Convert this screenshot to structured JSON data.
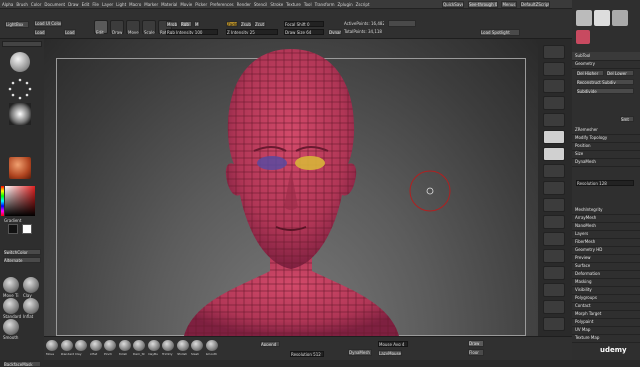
{
  "menubar": {
    "items": [
      "Alpha",
      "Brush",
      "Color",
      "Document",
      "Draw",
      "Edit",
      "File",
      "Layer",
      "Light",
      "Macro",
      "Marker",
      "Material",
      "Movie",
      "Picker",
      "Preferences",
      "Render",
      "Stencil",
      "Stroke",
      "Texture",
      "Tool",
      "Transform",
      "Zplugin",
      "Zscript"
    ],
    "quicksave": "QuickSave",
    "seethrough": "See-through 0",
    "menus": "Menus",
    "default_script": "DefaultZScript"
  },
  "toolbar": {
    "lightbox": "LightBox",
    "load_ui_colors": "Load UI Colors",
    "load": "Load",
    "save": "Load",
    "edit": "Edit",
    "draw": "Draw",
    "move": "Move",
    "scale": "Scale",
    "rotate": "Rotate",
    "mrgb": "Mrgb",
    "rgb": "Rgb",
    "m": "M",
    "zadd": "Zadd",
    "zsub": "Zsub",
    "zcut": "Zcut",
    "rgb_intensity": "Rgb Intensity 100",
    "z_intensity": "Z Intensity 25",
    "focal_shift": "Focal Shift 0",
    "draw_size": "Draw Size 64",
    "dynamic": "Dynamic",
    "active_points": "ActivePoints: 16,482",
    "total_points": "TotalPoints: 34,118",
    "load_spotlight": "Load Spotlight"
  },
  "left": {
    "lightbox_label": "LightBox",
    "gradient": "Gradient",
    "switch_color": "SwitchColor",
    "alternate": "Alternate",
    "brush_labels": [
      "Move Ti",
      "Clay",
      "Standard",
      "Inflat",
      "Smooth"
    ],
    "backface_mask": "BackfaceMask"
  },
  "right": {
    "subtool": "SubTool",
    "geometry": "Geometry",
    "layers": "Layers",
    "fibermesh": "FiberMesh",
    "geometry_hd": "Geometry HD",
    "preview": "Preview",
    "surface": "Surface",
    "deformation": "Deformation",
    "masking": "Masking",
    "visibility": "Visibility",
    "polygroups": "Polygroups",
    "contact": "Contact",
    "morph_target": "Morph Target",
    "polypaint": "Polypaint",
    "uv_map": "UV Map",
    "texture_map": "Texture Map",
    "arraymesh": "ArrayMesh",
    "nanomesh": "NanoMesh",
    "subdivide": "Subdivide",
    "dynamesh": "DynaMesh",
    "zremesher": "ZRemesher",
    "modify_topology": "Modify Topology",
    "position": "Position",
    "size": "Size",
    "mesh_integrity": "MeshIntegrity",
    "resolution": "Resolution 128",
    "smt": "Smt",
    "del_higher": "Del Higher",
    "del_lower": "Del Lower",
    "reconstruct": "Reconstruct Subdiv"
  },
  "bottom": {
    "tool_labels": [
      "Move",
      "Standard",
      "Clay",
      "Inflat",
      "Pinch",
      "Polish",
      "Dam_St",
      "ClayBu",
      "TrimDy",
      "hPolish",
      "Slash",
      "Smooth"
    ],
    "append": "Append",
    "resolution": "Resolution 512",
    "dynamesh": "DynaMesh",
    "mouse_avg": "Mouse Avg 4",
    "lazy_mouse": "LazyMouse",
    "draw": "Draw",
    "floor": "Floor"
  },
  "colors": {
    "head": "#b83a5a",
    "accent": "#e08a1a"
  },
  "watermark": "udemy"
}
